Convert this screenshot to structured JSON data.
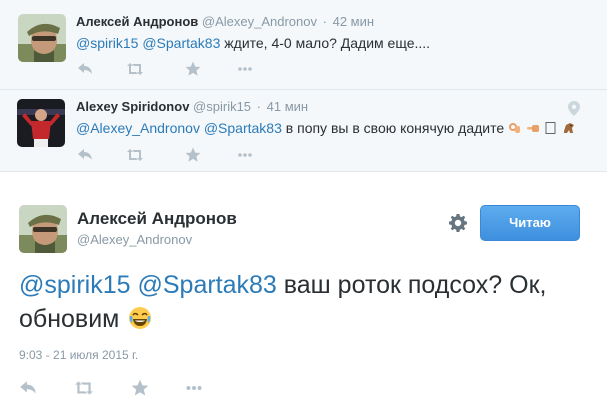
{
  "replies": [
    {
      "fullname": "Алексей Андронов",
      "handle": "@Alexey_Andronov",
      "time": "42 мин",
      "mention_1": "@spirik15",
      "mention_2": "@Spartak83",
      "text": " ждите, 4-0 мало? Дадим еще...."
    },
    {
      "fullname": "Alexey Spiridonov",
      "handle": "@spirik15",
      "time": "41 мин",
      "mention_1": "@Alexey_Andronov",
      "mention_2": "@Spartak83",
      "text": " в попу вы в свою конячую дадите"
    }
  ],
  "main_tweet": {
    "fullname": "Алексей Андронов",
    "handle": "@Alexey_Andronov",
    "follow_label": "Читаю",
    "mention_1": "@spirik15",
    "mention_2": "@Spartak83",
    "text": " ваш роток подсох? Ок, обновим",
    "date": "9:03 - 21 июля 2015 г."
  },
  "colors": {
    "link": "#2b7bb9",
    "button": "#4a9fe8",
    "muted": "#8899a6",
    "reply_bg": "#f5f8fa"
  },
  "icons": [
    "reply-icon",
    "retweet-icon",
    "favorite-icon",
    "more-icon",
    "location-pin-icon",
    "gear-icon",
    "laughing-emoji-icon"
  ]
}
